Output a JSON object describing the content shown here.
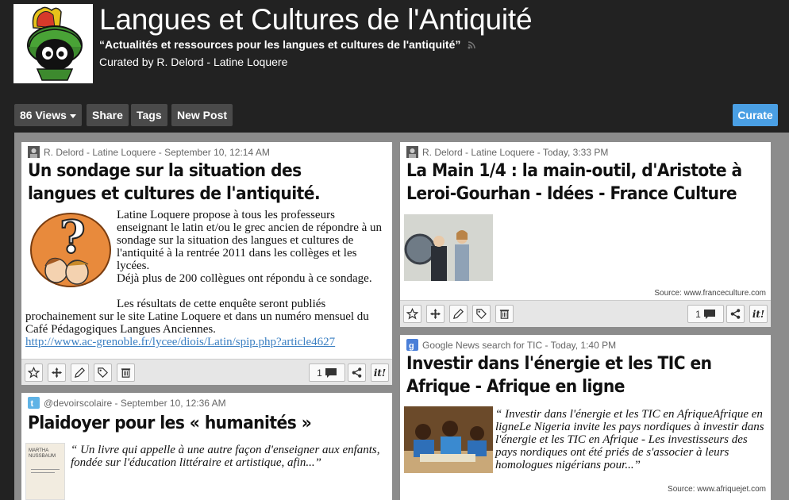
{
  "header": {
    "title": "Langues et Cultures de l'Antiquité",
    "subtitle": "“Actualités et ressources pour les langues et cultures de l'antiquité”",
    "curated_by": "Curated by R. Delord - Latine Loquere",
    "logo_icon": "marvin-martian-logo"
  },
  "toolbar": {
    "views_label": "86 Views",
    "share_label": "Share",
    "tags_label": "Tags",
    "newpost_label": "New Post",
    "curate_label": "Curate"
  },
  "colors": {
    "background": "#222222",
    "content_bg": "#8c8c8c",
    "curate_blue": "#4a9fe4",
    "link": "#3a7fc2"
  },
  "posts": [
    {
      "meta": "R. Delord - Latine Loquere - September 10, 12:14 AM",
      "title": "Un sondage sur la situation des langues et cultures de l'antiquité.",
      "p1": "Latine Loquere propose à tous les professeurs enseignant le latin et/ou le grec ancien de répondre à un sondage sur la situation des langues et cultures de l'antiquité à la rentrée 2011 dans les collèges et les lycées.",
      "p2": "Déjà plus de 200 collègues ont répondu à ce sondage.",
      "p3": "Les résultats de cette enquête seront publiés prochainement sur le site Latine Loquere et dans un numéro mensuel du Café Pédagogiques Langues Anciennes.",
      "link": "http://www.ac-grenoble.fr/lycee/diois/Latin/spip.php?article4627",
      "comments": "1"
    },
    {
      "meta": "R. Delord - Latine Loquere - Today, 3:33 PM",
      "title": "La Main 1/4 : la main-outil, d'Aristote à Leroi-Gourhan - Idées - France Culture",
      "source": "Source: www.franceculture.com",
      "comments": "1"
    },
    {
      "meta": "Google News search for TIC - Today, 1:40 PM",
      "title": "Investir dans l'énergie et les TIC en Afrique - Afrique en ligne",
      "quote": "“ Investir dans l'énergie et les TIC en AfriqueAfrique en ligneLe Nigeria invite les pays nordiques à investir dans l'énergie et les TIC en Afrique - Les investisseurs des pays nordiques ont été priés de s'associer à leurs homologues nigérians pour...”",
      "source": "Source: www.afriquejet.com"
    },
    {
      "meta": "@devoirscolaire - September 10, 12:36 AM",
      "title": "Plaidoyer pour les « humanités »",
      "quote": "“ Un livre qui appelle à une autre façon d'enseigner aux enfants, fondée sur l'éducation littéraire et artistique, afin...”",
      "book_text": "MARTHA NUSSBAUM"
    }
  ],
  "actions": {
    "icons": [
      "star-icon",
      "move-icon",
      "edit-icon",
      "tag-icon",
      "trash-icon",
      "comment-icon",
      "share-icon",
      "scoop-it-icon"
    ],
    "scoopit_label": "it!"
  }
}
